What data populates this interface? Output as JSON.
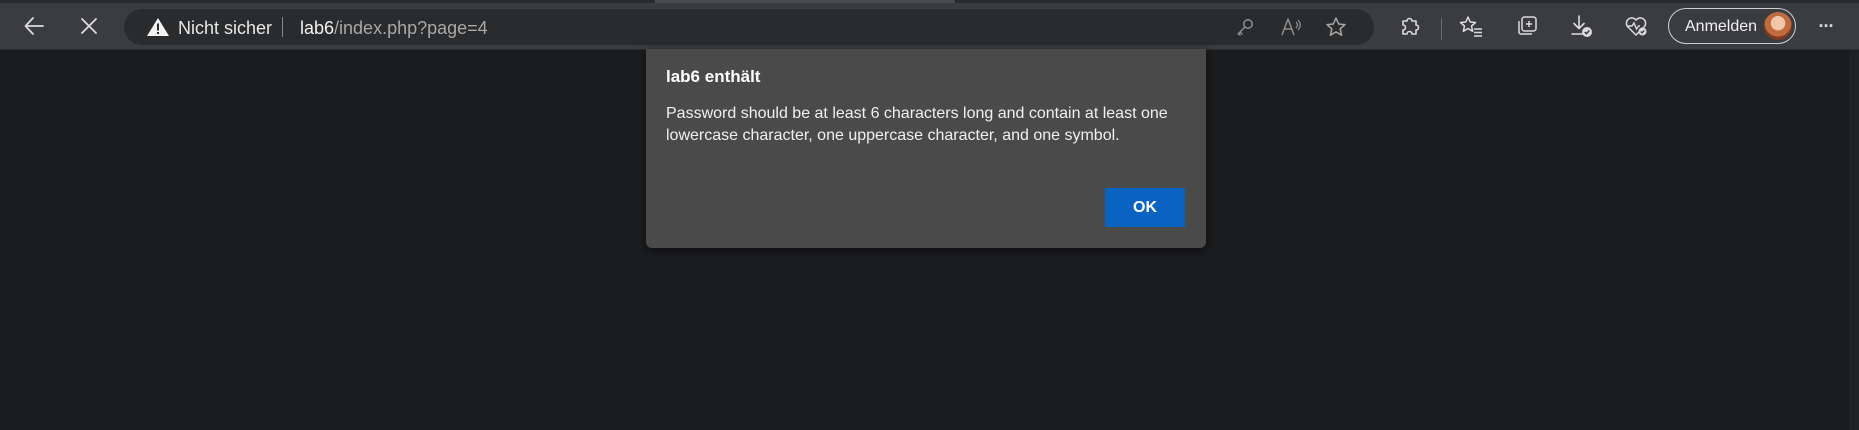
{
  "browser": {
    "security_label": "Nicht sicher",
    "url_host": "lab6",
    "url_path": "/index.php?page=4",
    "signin_label": "Anmelden",
    "more_label": "···"
  },
  "icons": {
    "back": "back-arrow-icon",
    "stop": "stop-x-icon",
    "warning": "warning-icon",
    "key": "key-icon",
    "read_aloud": "read-aloud-icon",
    "favorite": "star-icon",
    "extensions": "puzzle-icon",
    "favorites": "favorites-icon",
    "collections": "collections-icon",
    "downloads": "download-icon",
    "health": "heart-pulse-icon",
    "more": "more-icon"
  },
  "dialog": {
    "title": "lab6 enthält",
    "message": "Password should be at least 6 characters long and contain at least one lowercase character, one uppercase character, and one symbol.",
    "ok_label": "OK"
  },
  "colors": {
    "accent": "#0a63c0",
    "toolbar": "#3b3c3f",
    "page": "#1b1c1e",
    "dialog": "#4a4a4a"
  }
}
